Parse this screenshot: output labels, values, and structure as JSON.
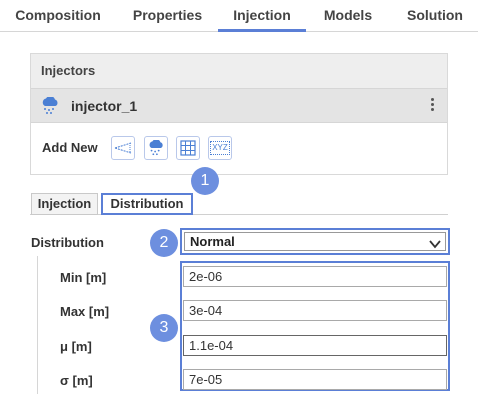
{
  "top_tabs": [
    "Composition",
    "Properties",
    "Injection",
    "Models",
    "Solution"
  ],
  "active_tab": "Injection",
  "injectors": {
    "title": "Injectors",
    "items": [
      {
        "name": "injector_1"
      }
    ],
    "add_new_label": "Add New",
    "add_buttons": [
      "cone-injector-icon",
      "cloud-injector-icon",
      "grid-injector-icon",
      "xyz-injector-icon"
    ],
    "xyz_text": "XYZ"
  },
  "sub_tabs": [
    "Injection",
    "Distribution"
  ],
  "active_sub_tab": "Distribution",
  "distribution": {
    "label": "Distribution",
    "selected": "Normal",
    "params": [
      {
        "label": "Min [m]",
        "value": "2e-06"
      },
      {
        "label": "Max [m]",
        "value": "3e-04"
      },
      {
        "label": "μ [m]",
        "value": "1.1e-04"
      },
      {
        "label": "σ [m]",
        "value": "7e-05"
      }
    ]
  },
  "callouts": [
    "1",
    "2",
    "3"
  ],
  "colors": {
    "accent": "#5b7fd6",
    "badge": "#6d8fdf",
    "icon_blue": "#4a7fd4"
  }
}
